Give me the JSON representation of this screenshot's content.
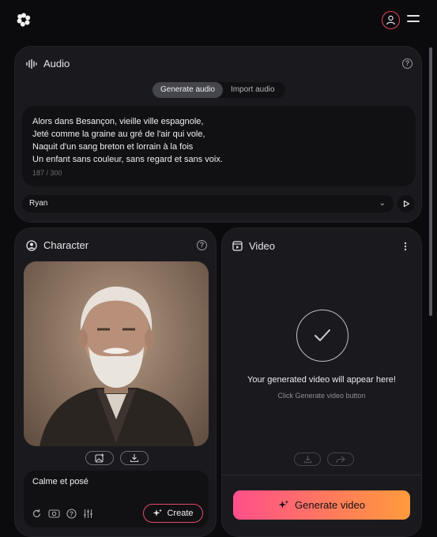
{
  "header": {
    "logo_icon": "flower-logo-icon",
    "user_icon": "user-circle-icon",
    "menu_icon": "hamburger-menu-icon",
    "accent": "#e0495b"
  },
  "audio": {
    "title": "Audio",
    "tabs": [
      {
        "label": "Generate audio",
        "active": true
      },
      {
        "label": "Import audio",
        "active": false
      }
    ],
    "text_lines": [
      "Alors dans Besançon, vieille ville espagnole,",
      "Jeté comme la graine au gré de l'air qui vole,",
      "Naquit d'un sang breton et lorrain à la fois",
      "Un enfant sans couleur, sans regard et sans voix."
    ],
    "counter": "187 / 300",
    "voice": "Ryan"
  },
  "character": {
    "title": "Character",
    "prompt": "Calme et posé",
    "create_label": "Create"
  },
  "video": {
    "title": "Video",
    "placeholder_title": "Your generated video will appear here!",
    "placeholder_sub": "Click Generate video button",
    "generate_label": "Generate video",
    "gradient": [
      "#ff4f8b",
      "#ff7a5c",
      "#ff9a3c"
    ]
  }
}
